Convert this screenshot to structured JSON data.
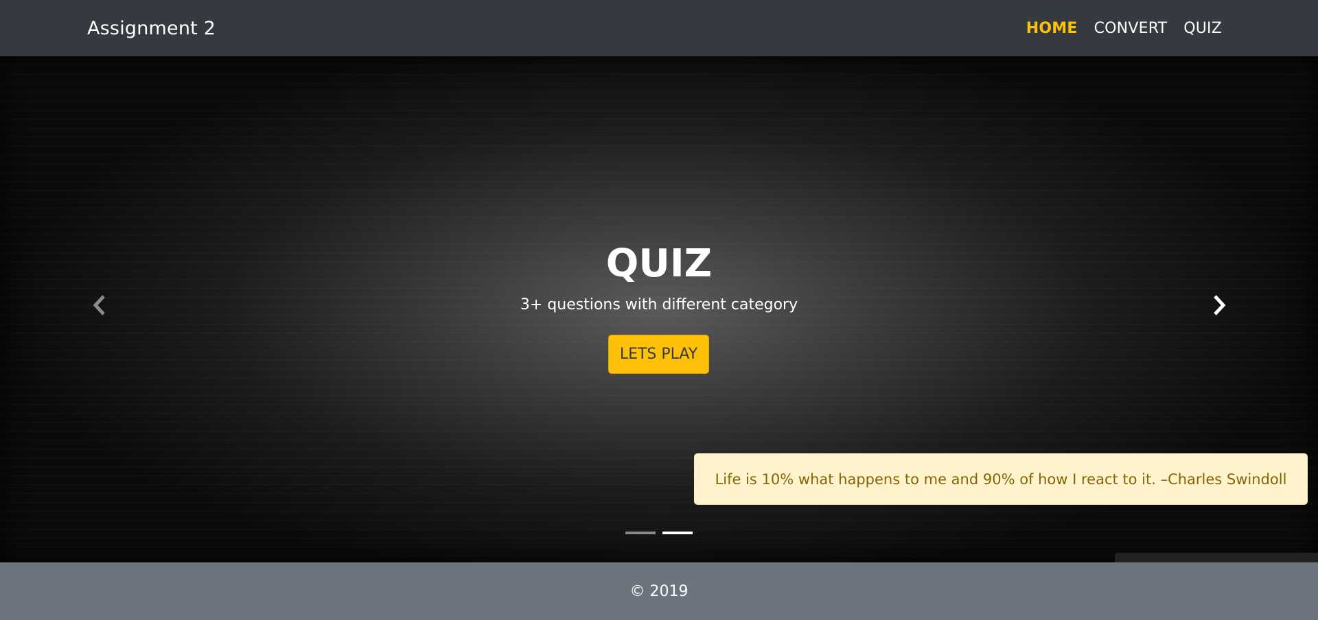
{
  "navbar": {
    "brand": "Assignment 2",
    "links": [
      {
        "label": "HOME",
        "active": true
      },
      {
        "label": "CONVERT",
        "active": false
      },
      {
        "label": "QUIZ",
        "active": false
      }
    ]
  },
  "hero": {
    "title": "QUIZ",
    "subtitle": "3+ questions with different category",
    "button_label": "LETS PLAY",
    "prev_icon": "chevron-left-icon",
    "next_icon": "chevron-right-icon",
    "indicators": 2,
    "active_indicator": 2
  },
  "quote": {
    "text": "Life is 10% what happens to me and 90% of how I react to it. –Charles Swindoll"
  },
  "footer": {
    "text": "© 2019"
  },
  "colors": {
    "navbar_bg": "#343a40",
    "accent": "#ffc107",
    "quote_bg": "#fff3cd",
    "quote_text": "#856404",
    "footer_bg": "#6c757d"
  }
}
